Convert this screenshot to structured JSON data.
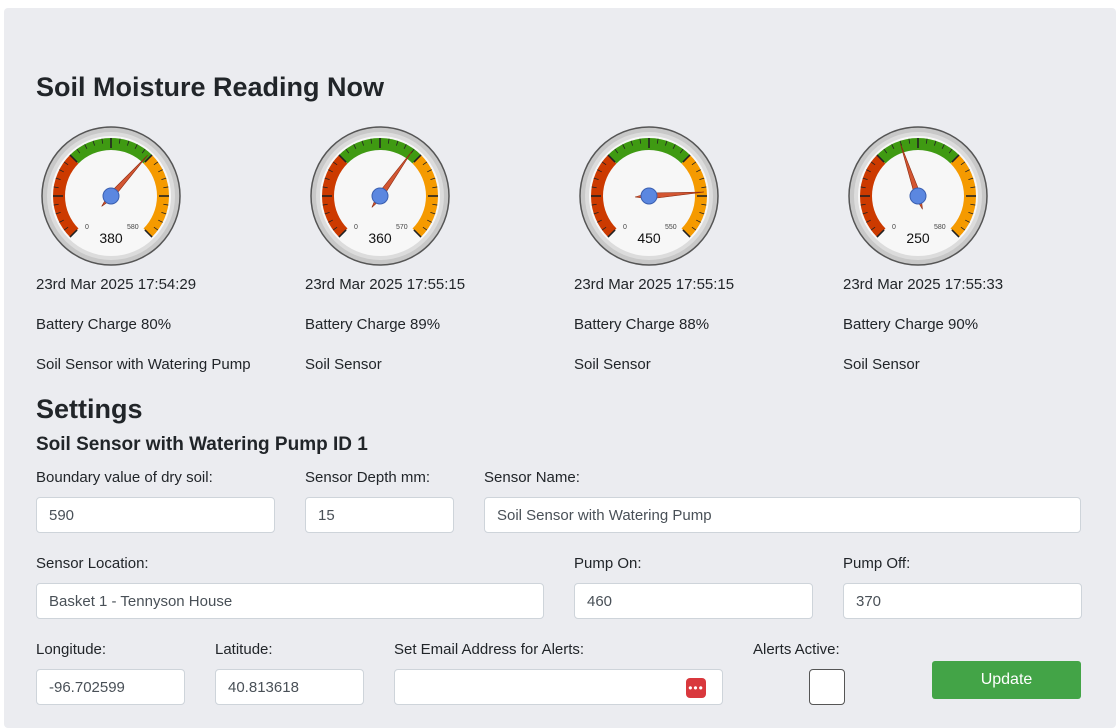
{
  "header": {
    "title": "Soil Moisture Reading Now"
  },
  "gauges": [
    {
      "value": 380,
      "min_label": "0",
      "max_label": "580",
      "max": 580,
      "timestamp": "23rd Mar 2025 17:54:29",
      "battery": "Battery Charge 80%",
      "sensor_type": "Soil Sensor with Watering Pump"
    },
    {
      "value": 360,
      "min_label": "0",
      "max_label": "570",
      "max": 570,
      "timestamp": "23rd Mar 2025 17:55:15",
      "battery": "Battery Charge 89%",
      "sensor_type": "Soil Sensor"
    },
    {
      "value": 450,
      "min_label": "0",
      "max_label": "550",
      "max": 550,
      "timestamp": "23rd Mar 2025 17:55:15",
      "battery": "Battery Charge 88%",
      "sensor_type": "Soil Sensor"
    },
    {
      "value": 250,
      "min_label": "0",
      "max_label": "580",
      "max": 580,
      "timestamp": "23rd Mar 2025 17:55:33",
      "battery": "Battery Charge 90%",
      "sensor_type": "Soil Sensor"
    }
  ],
  "gauge_colors": {
    "red": "#cc3a00",
    "green": "#3f9a12",
    "orange": "#f59a00",
    "needle": "#d35632",
    "hub": "#5b87e0"
  },
  "settings": {
    "title": "Settings",
    "subtitle": "Soil Sensor with Watering Pump ID 1",
    "boundary": {
      "label": "Boundary value of dry soil:",
      "value": "590"
    },
    "depth": {
      "label": "Sensor Depth mm:",
      "value": "15"
    },
    "name": {
      "label": "Sensor Name:",
      "value": "Soil Sensor with Watering Pump"
    },
    "location": {
      "label": "Sensor Location:",
      "value": "Basket 1 - Tennyson House"
    },
    "pump_on": {
      "label": "Pump On:",
      "value": "460"
    },
    "pump_off": {
      "label": "Pump Off:",
      "value": "370"
    },
    "longitude": {
      "label": "Longitude:",
      "value": "-96.702599"
    },
    "latitude": {
      "label": "Latitude:",
      "value": "40.813618"
    },
    "email": {
      "label": "Set Email Address for Alerts:",
      "value": "",
      "icon": "password-manager-icon"
    },
    "alerts": {
      "label": "Alerts Active:",
      "checked": false
    },
    "update_label": "Update"
  },
  "accent_colors": {
    "button": "#43a447",
    "panel_bg": "#ebecf0"
  }
}
